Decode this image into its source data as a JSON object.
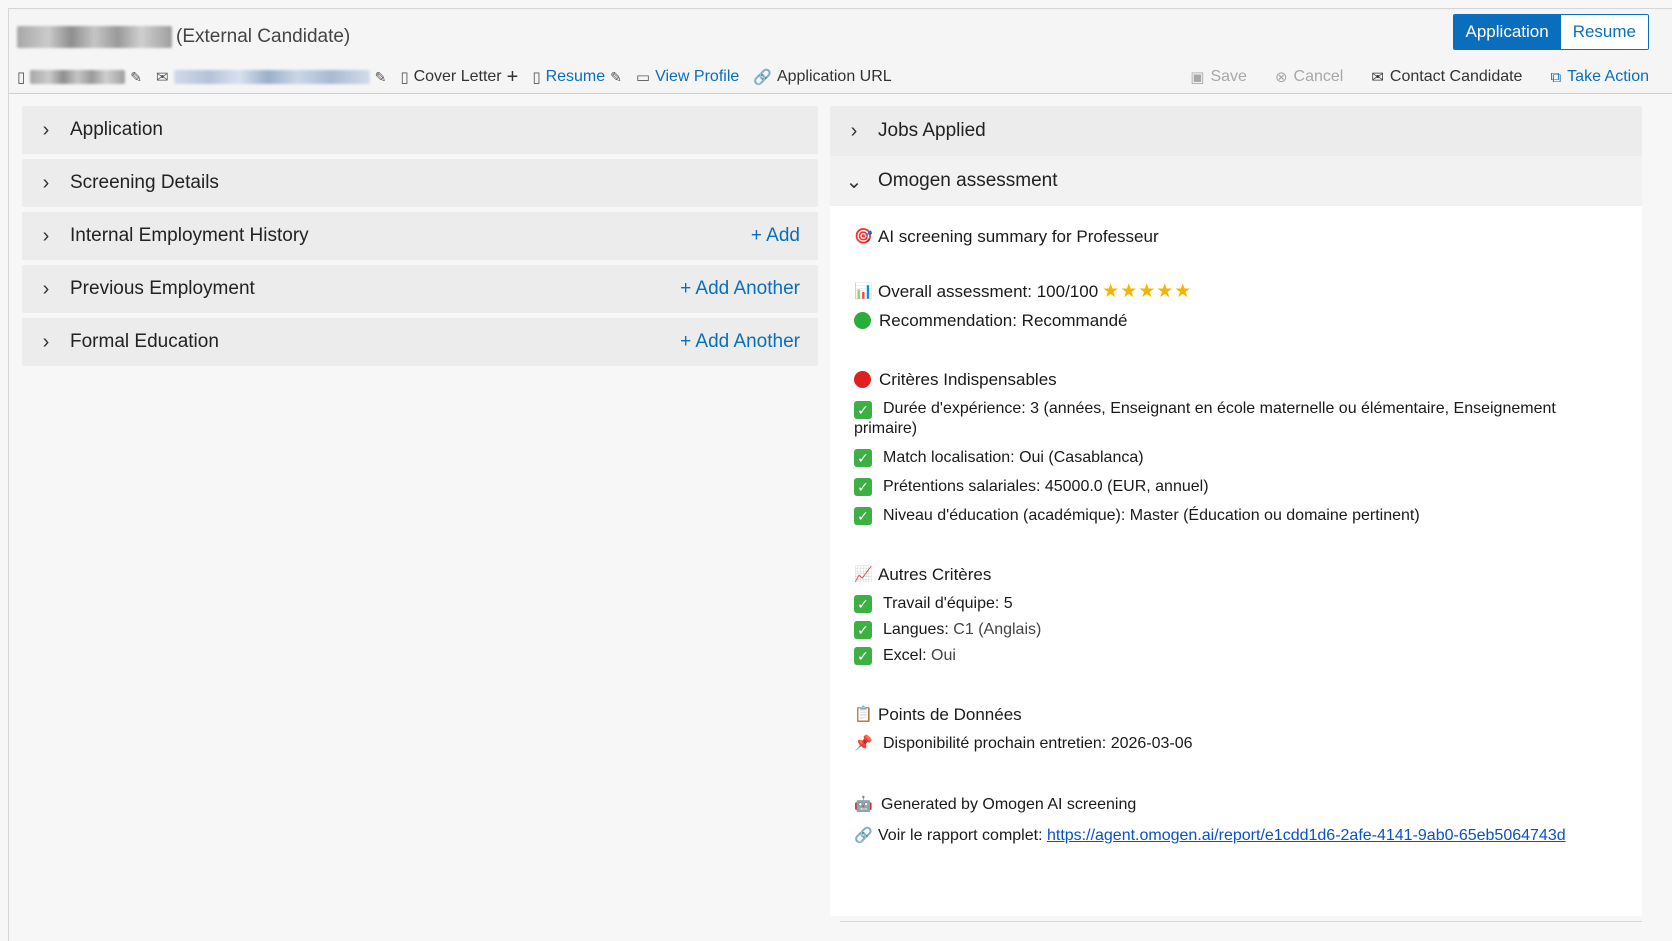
{
  "header": {
    "candidate_suffix": "(External Candidate)",
    "info": {
      "cover_letter": "Cover Letter",
      "resume": "Resume",
      "view_profile": "View Profile",
      "application_url": "Application URL"
    },
    "toggle": {
      "application": "Application",
      "resume": "Resume",
      "selected": "Application"
    },
    "actions": {
      "save": "Save",
      "cancel": "Cancel",
      "contact": "Contact Candidate",
      "take_action": "Take Action"
    }
  },
  "left_sections": [
    {
      "label": "Application",
      "action": ""
    },
    {
      "label": "Screening Details",
      "action": ""
    },
    {
      "label": "Internal Employment History",
      "action": "+ Add"
    },
    {
      "label": "Previous Employment",
      "action": "+ Add Another"
    },
    {
      "label": "Formal Education",
      "action": "+ Add Another"
    }
  ],
  "right_sections": {
    "jobs_applied": "Jobs Applied",
    "assessment_title": "Omogen assessment"
  },
  "assessment": {
    "summary": "AI screening summary for Professeur",
    "overall": "Overall assessment: 100/100",
    "stars": "★★★★★",
    "recommendation": "Recommendation: Recommandé",
    "must_title": "Critères Indispensables",
    "must": [
      "Durée d'expérience: 3 (années, Enseignant en école maternelle ou élémentaire, Enseignement",
      "primaire)",
      "Match localisation: Oui (Casablanca)",
      "Prétentions salariales: 45000.0 (EUR, annuel)",
      "Niveau d'éducation (académique): Master (Éducation ou domaine pertinent)"
    ],
    "other_title": "Autres Critères",
    "other": [
      {
        "k": "Travail d'équipe:",
        "v": "5"
      },
      {
        "k": "Langues:",
        "v": "C1 (Anglais)"
      },
      {
        "k": "Excel:",
        "v": "Oui"
      }
    ],
    "data_title": "Points de Données",
    "availability": "Disponibilité prochain entretien: 2026-03-06",
    "generated": "Generated by Omogen AI screening",
    "report_label": "Voir le rapport complet:",
    "report_url": "https://agent.omogen.ai/report/e1cdd1d6-2afe-4141-9ab0-65eb5064743d"
  },
  "colors": {
    "accent": "#0a6ebd",
    "check": "#3cb043",
    "green_dot": "#27ae3c",
    "red_dot": "#e02020",
    "star": "#f4b400"
  },
  "icons": [
    "phone-icon",
    "pencil-icon",
    "mail-icon",
    "document-icon",
    "plus-icon",
    "profile-card-icon",
    "link-icon",
    "save-icon",
    "cancel-icon",
    "envelope-icon",
    "external-link-icon",
    "chevron-right-icon",
    "chevron-down-icon",
    "target-icon",
    "bar-chart-icon",
    "green-circle-icon",
    "red-circle-icon",
    "check-box-icon",
    "trend-chart-icon",
    "clipboard-icon",
    "pushpin-icon",
    "robot-icon"
  ]
}
